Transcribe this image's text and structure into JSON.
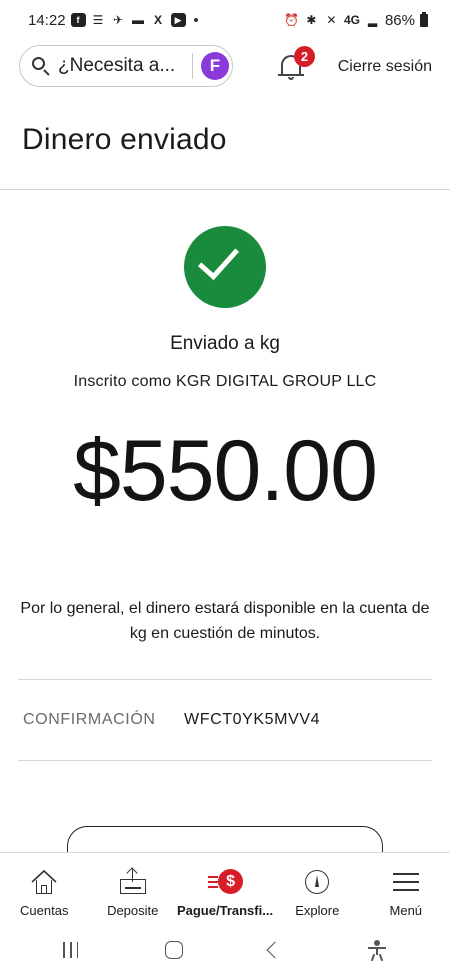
{
  "status_bar": {
    "time": "14:22",
    "network": "4G",
    "battery": "86%"
  },
  "header": {
    "search_placeholder": "¿Necesita a...",
    "notification_count": "2",
    "logout_label": "Cierre sesión"
  },
  "page": {
    "title": "Dinero enviado"
  },
  "confirmation": {
    "sent_to": "Enviado a kg",
    "enrolled_as": "Inscrito como KGR DIGITAL GROUP LLC",
    "amount": "$550.00",
    "availability_note": "Por lo general, el dinero estará disponible en la cuenta de kg en cuestión de minutos.",
    "confirmation_label": "CONFIRMACIÓN",
    "confirmation_number": "WFCT0YK5MVV4"
  },
  "bottom_nav": {
    "items": [
      {
        "label": "Cuentas",
        "icon": "home-icon"
      },
      {
        "label": "Deposite",
        "icon": "deposit-icon"
      },
      {
        "label": "Pague/Transfi...",
        "icon": "pay-transfer-icon",
        "active": true
      },
      {
        "label": "Explore",
        "icon": "compass-icon"
      },
      {
        "label": "Menú",
        "icon": "menu-icon"
      }
    ]
  },
  "colors": {
    "success_green": "#1a8a3d",
    "brand_red": "#d71e28",
    "fargo_purple": "#8a3ad8"
  }
}
